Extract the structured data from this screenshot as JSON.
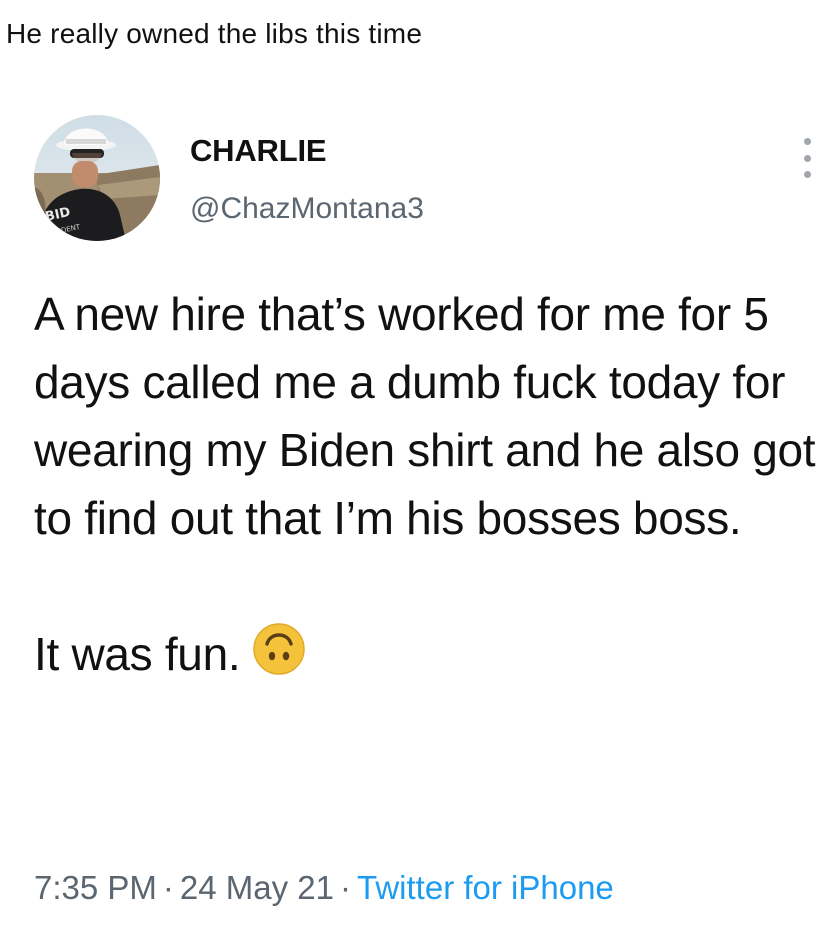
{
  "caption": "He really owned the libs this time",
  "tweet": {
    "display_name": "CHARLIE",
    "handle": "@ChazMontana3",
    "text_paragraph_1": "A new hire that’s worked for me for 5 days called me a dumb fuck today for wearing my Biden shirt and he also got to find out that I’m his bosses boss.",
    "text_paragraph_2": "It was fun.",
    "emoji_icon": "upside-down-face-emoji",
    "time": "7:35 PM",
    "date": "24 May 21",
    "separator": "·",
    "source": "Twitter for iPhone",
    "colors": {
      "text": "#111111",
      "secondary": "#5b6670",
      "link": "#1d9bf0",
      "emoji": "#f5c33b"
    },
    "avatar_shirt_text": "BID"
  }
}
